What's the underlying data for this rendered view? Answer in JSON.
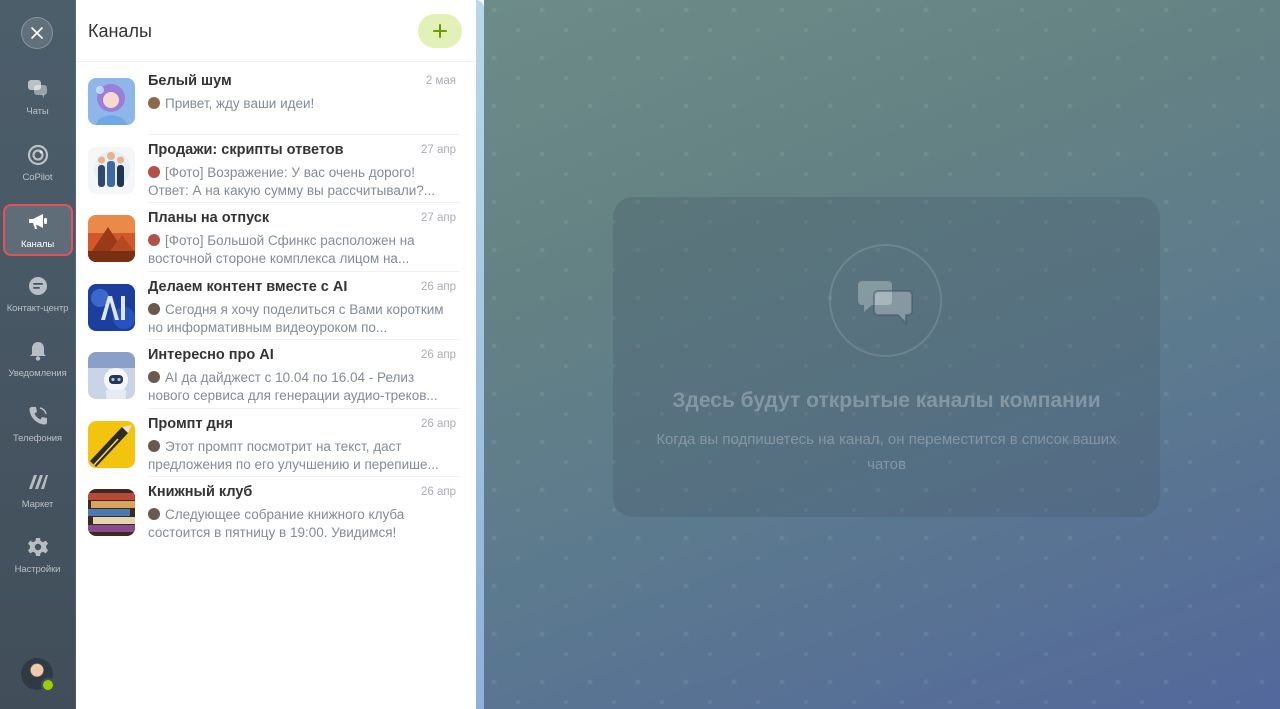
{
  "sidebar": {
    "items": [
      {
        "label": "Чаты",
        "icon": "chats-icon"
      },
      {
        "label": "CoPilot",
        "icon": "copilot-icon"
      },
      {
        "label": "Каналы",
        "icon": "megaphone-icon",
        "active": true
      },
      {
        "label": "Контакт-центр",
        "icon": "contact-center-icon"
      },
      {
        "label": "Уведомления",
        "icon": "bell-icon"
      },
      {
        "label": "Телефония",
        "icon": "phone-icon"
      },
      {
        "label": "Маркет",
        "icon": "market-icon"
      },
      {
        "label": "Настройки",
        "icon": "gear-icon"
      }
    ],
    "status_color": "#9dcf00",
    "active_highlight_color": "#e4515a"
  },
  "panel": {
    "title": "Каналы",
    "add_button_color": "#e2f1b7",
    "channels": [
      {
        "name": "Белый шум",
        "date": "2 мая",
        "preview": [
          "Привет, жду ваши идеи!"
        ]
      },
      {
        "name": "Продажи: скрипты ответов",
        "date": "27 апр",
        "preview": [
          "[Фото] Возражение: У вас очень дорого!",
          "Ответ: А на какую сумму вы рассчитывали?..."
        ]
      },
      {
        "name": "Планы на отпуск",
        "date": "27 апр",
        "preview": [
          "[Фото] Большой Сфинкс расположен на",
          "восточной стороне комплекса лицом на..."
        ]
      },
      {
        "name": "Делаем контент вместе с AI",
        "date": "26 апр",
        "preview": [
          "Сегодня я хочу поделиться с Вами коротким",
          "но информативным видеоуроком по..."
        ]
      },
      {
        "name": "Интересно про AI",
        "date": "26 апр",
        "preview": [
          "AI да дайджест с 10.04 по 16.04 - Релиз",
          "нового сервиса для генерации аудио-треков..."
        ]
      },
      {
        "name": "Промпт дня",
        "date": "26 апр",
        "preview": [
          "Этот промпт посмотрит на текст, даст",
          "предложения по его улучшению и перепише..."
        ]
      },
      {
        "name": "Книжный клуб",
        "date": "26 апр",
        "preview": [
          "Следующее собрание книжного клуба",
          "состоится в пятницу в 19:00. Увидимся!"
        ]
      }
    ]
  },
  "empty_state": {
    "title": "Здесь будут открытые каналы компании",
    "subtitle": "Когда вы подпишетесь на канал, он переместится в список ваших чатов",
    "icon": "chat-bubbles-icon"
  }
}
